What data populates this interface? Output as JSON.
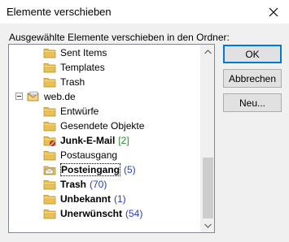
{
  "window": {
    "title": "Elemente verschieben"
  },
  "prompt": "Ausgewählte Elemente verschieben in den Ordner:",
  "buttons": {
    "ok": "OK",
    "cancel": "Abbrechen",
    "new": "Neu..."
  },
  "tree": {
    "items": [
      {
        "label": "Sent Items",
        "count": "",
        "bold": false
      },
      {
        "label": "Templates",
        "count": "",
        "bold": false
      },
      {
        "label": "Trash",
        "count": "",
        "bold": false
      },
      {
        "label": "web.de",
        "count": "",
        "bold": false,
        "expander": "−"
      },
      {
        "label": "Entwürfe",
        "count": "",
        "bold": false
      },
      {
        "label": "Gesendete Objekte",
        "count": "",
        "bold": false
      },
      {
        "label": "Junk-E-Mail",
        "count": "[2]",
        "bold": true,
        "count_color": "#2a8a2a"
      },
      {
        "label": "Postausgang",
        "count": "",
        "bold": false
      },
      {
        "label": "Posteingang",
        "count": "(5)",
        "bold": true,
        "selected": true,
        "count_color": "#1f3dd6"
      },
      {
        "label": "Trash",
        "count": "(70)",
        "bold": true,
        "count_color": "#1f3dd6"
      },
      {
        "label": "Unbekannt",
        "count": "(1)",
        "bold": true,
        "count_color": "#1f3dd6"
      },
      {
        "label": "Unerwünscht",
        "count": "(54)",
        "bold": true,
        "count_color": "#1f3dd6"
      }
    ]
  },
  "icons": {
    "close": "close-icon",
    "folder": "folder-icon",
    "account": "mail-account-icon",
    "junk": "junk-folder-icon",
    "inbox": "inbox-folder-icon",
    "scroll_up": "scroll-up-arrow-icon",
    "scroll_down": "scroll-down-arrow-icon"
  },
  "colors": {
    "folder": "#e8c05a",
    "count_blue": "#1f3dd6",
    "count_green": "#2a8a2a",
    "accent": "#0078d7"
  }
}
